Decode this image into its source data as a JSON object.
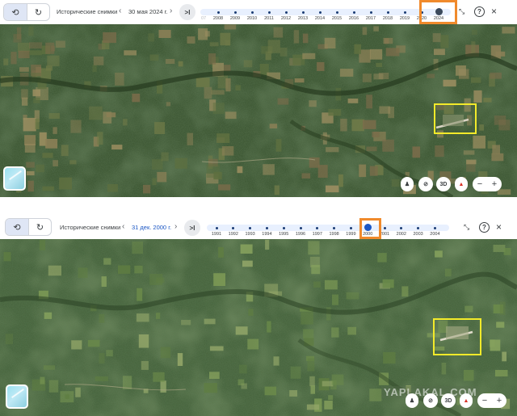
{
  "top": {
    "label": "Исторические снимки",
    "date": "30 мая 2024 г.",
    "years": [
      "2008",
      "2009",
      "2010",
      "2011",
      "2012",
      "2013",
      "2014",
      "2015",
      "2016",
      "2017",
      "2018",
      "2019",
      "2020",
      "2024"
    ],
    "year_prefix_faded": "07",
    "selected_year": "2024",
    "jump_label": ">I"
  },
  "bottom": {
    "label": "Исторические снимки",
    "date": "31 дек. 2000 г.",
    "years": [
      "1991",
      "1992",
      "1993",
      "1994",
      "1995",
      "1996",
      "1997",
      "1998",
      "1999",
      "2000",
      "2001",
      "2002",
      "2003",
      "2004"
    ],
    "selected_year": "2000",
    "jump_label": ">I",
    "watermark": "YAPLAKAL.COM"
  },
  "controls": {
    "prev_arrow": "‹",
    "next_arrow": "›",
    "help": "?",
    "close": "×",
    "collapse": "⤡",
    "threed": "3D",
    "zoom_out": "−",
    "zoom_in": "+",
    "compass": "▲",
    "pegman": "♟",
    "hide": "⊘"
  },
  "colors": {
    "highlight_orange": "#f08a2c",
    "highlight_yellow": "#f3ea2a",
    "forest_dark": "#2f4a26",
    "forest_light": "#48663a"
  }
}
